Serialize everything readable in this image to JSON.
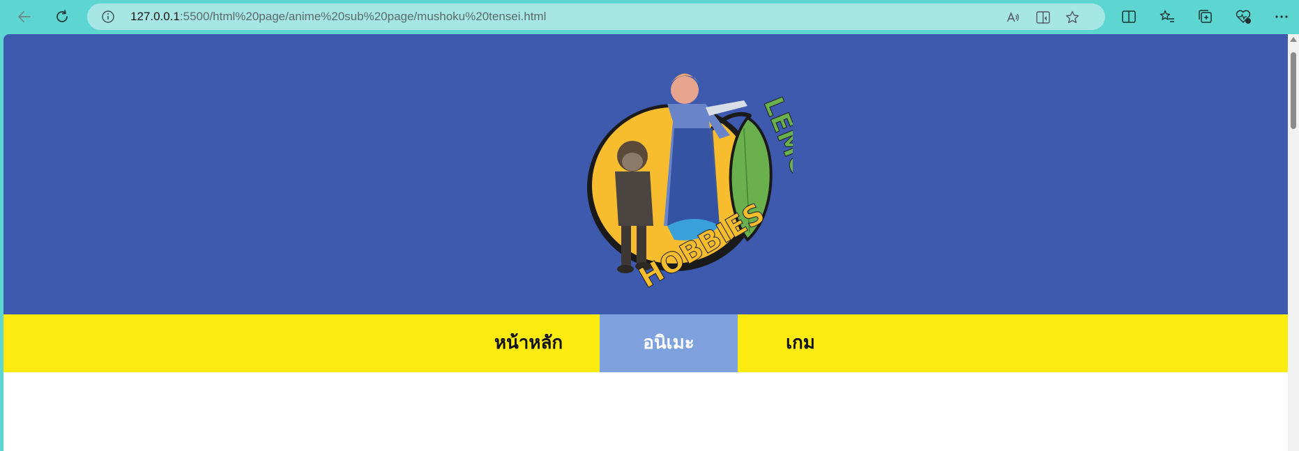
{
  "browser": {
    "url_host": "127.0.0.1",
    "url_rest": ":5500/html%20page/anime%20sub%20page/mushoku%20tensei.html"
  },
  "site": {
    "logo": {
      "text_top": "LEMON'S",
      "text_bottom": "HOBBIES"
    },
    "nav": [
      {
        "label": "หน้าหลัก"
      },
      {
        "label": "อนิเมะ"
      },
      {
        "label": "เกม"
      }
    ]
  },
  "colors": {
    "chrome": "#5dd6d2",
    "hero": "#3e5aaf",
    "nav": "#fdea0e",
    "nav_active": "#7fa2df",
    "lemon": "#f7bd2f",
    "leaf": "#6ab04c"
  }
}
